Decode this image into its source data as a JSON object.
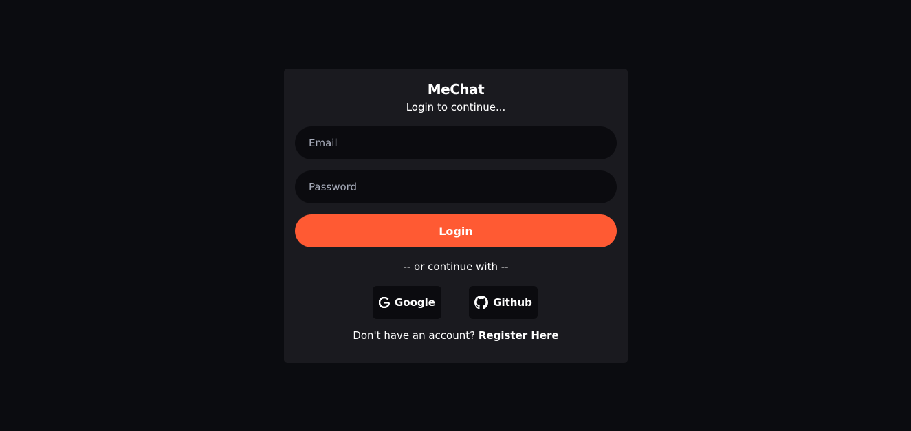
{
  "app": {
    "title": "MeChat",
    "subtitle": "Login to continue..."
  },
  "form": {
    "email_placeholder": "Email",
    "email_value": "",
    "password_placeholder": "Password",
    "password_value": "",
    "login_label": "Login"
  },
  "social": {
    "divider": "-- or continue with --",
    "google_label": "Google",
    "github_label": "Github",
    "google_icon": "google-icon",
    "github_icon": "github-icon"
  },
  "footer": {
    "prompt": "Don't have an account?",
    "register_label": "Register Here"
  },
  "colors": {
    "background": "#0b0c10",
    "card": "#1a1a1f",
    "input": "#0b0b0f",
    "accent": "#ff5a33",
    "placeholder": "#a7acba"
  }
}
